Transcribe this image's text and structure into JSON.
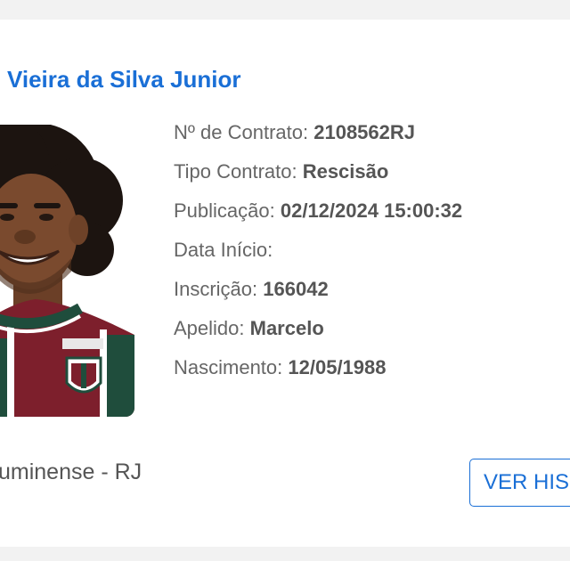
{
  "player": {
    "name": "Vieira da Silva Junior",
    "photo_icon": "player-portrait"
  },
  "details": {
    "contract_label": "Nº de Contrato: ",
    "contract_value": "2108562RJ",
    "type_label": "Tipo Contrato: ",
    "type_value": "Rescisão",
    "publication_label": "Publicação: ",
    "publication_value": "02/12/2024 15:00:32",
    "start_label": "Data Início:",
    "start_value": "",
    "registration_label": "Inscrição: ",
    "registration_value": "166042",
    "nickname_label": "Apelido: ",
    "nickname_value": "Marcelo",
    "birth_label": "Nascimento: ",
    "birth_value": "12/05/1988"
  },
  "club": {
    "name": "uminense - RJ"
  },
  "actions": {
    "history_label": "VER HIS"
  },
  "colors": {
    "accent": "#1a6fd6",
    "label_text": "#666666",
    "value_text": "#555555",
    "page_background": "#f2f2f2",
    "card_background": "#ffffff"
  }
}
